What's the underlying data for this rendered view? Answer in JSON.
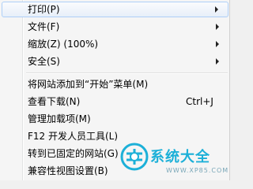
{
  "menu": {
    "items": [
      {
        "label": "打印(P)",
        "submenu": true
      },
      {
        "label": "文件(F)",
        "submenu": true
      },
      {
        "label": "缩放(Z) (100%)",
        "submenu": true
      },
      {
        "label": "安全(S)",
        "submenu": true
      },
      {
        "label": "将网站添加到“开始”菜单(M)"
      },
      {
        "label": "查看下载(N)",
        "shortcut": "Ctrl+J"
      },
      {
        "label": "管理加载项(M)"
      },
      {
        "label": "F12 开发人员工具(L)"
      },
      {
        "label": "转到已固定的网站(G)"
      },
      {
        "label": "兼容性视图设置(B)"
      }
    ]
  },
  "watermark": {
    "title": "系统大全",
    "url": "WWW.XP85.COM",
    "color": "#1cb0d8"
  }
}
